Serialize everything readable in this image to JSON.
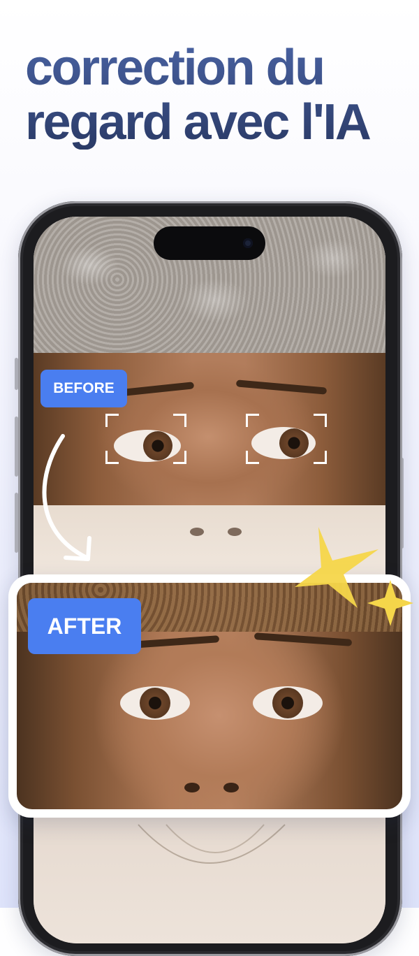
{
  "headline": {
    "line1": "correction du",
    "line2": "regard avec l'IA"
  },
  "labels": {
    "before": "BEFORE",
    "after": "AFTER"
  },
  "colors": {
    "headline_top": "#4962a2",
    "headline_bottom": "#2a3a66",
    "badge": "#4a7ef0",
    "star": "#f5d64a"
  },
  "icons": [
    "curved-arrow-icon",
    "focus-frame-icon",
    "sparkle-star-icon"
  ]
}
